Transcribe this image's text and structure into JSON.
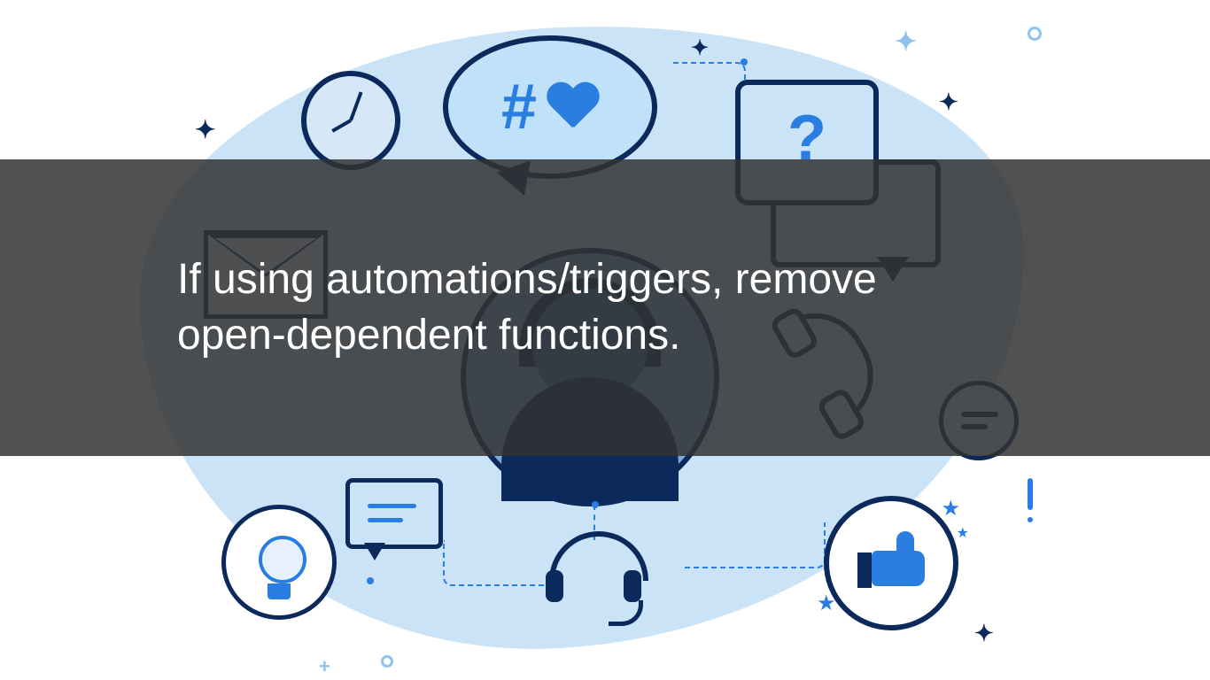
{
  "overlay": {
    "message": "If using automations/triggers, remove open-dependent functions."
  },
  "icons": {
    "clock": "clock-icon",
    "hash": "#",
    "question": "?",
    "bubble_hashheart": "speech-bubble-hash-heart",
    "question_card": "question-speech-card",
    "envelope": "envelope-icon",
    "small_chat": "chat-bubble-icon",
    "lightbulb": "lightbulb-icon",
    "headphones": "headset-icon",
    "phone": "phone-handset-icon",
    "chat_lines": "chat-lines-icon",
    "thumbs_up": "thumbs-up-icon",
    "avatar": "support-agent-avatar"
  },
  "colors": {
    "accent": "#2a7de1",
    "outline": "#0b2a5b",
    "blob": "#cbe3f7",
    "overlay": "rgba(50,50,50,0.85)"
  }
}
